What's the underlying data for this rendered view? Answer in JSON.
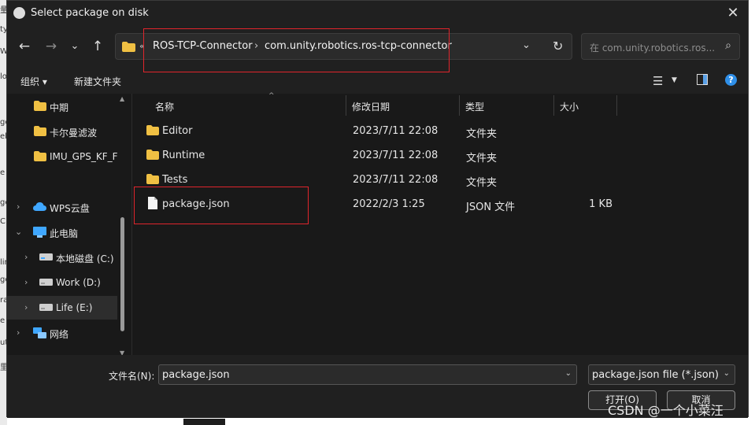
{
  "window": {
    "title": "Select package on disk",
    "close_glyph": "✕"
  },
  "nav": {
    "back_glyph": "←",
    "forward_glyph": "→",
    "recent_glyph": "⌄",
    "up_glyph": "↑",
    "overflow": "«",
    "breadcrumb": [
      "ROS-TCP-Connector",
      "com.unity.robotics.ros-tcp-connector"
    ],
    "separator": "›",
    "dropdown_glyph": "⌄",
    "refresh_glyph": "↻",
    "search_placeholder": "在 com.unity.robotics.ros...",
    "search_glyph": "⌕"
  },
  "toolbar": {
    "organize": "组织 ▾",
    "new_folder": "新建文件夹",
    "view_glyph": "☰",
    "view_caret": "▼",
    "help_glyph": "?"
  },
  "sidebar": {
    "items": [
      {
        "label": "中期",
        "icon": "folder-icon",
        "chevron": ""
      },
      {
        "label": "卡尔曼滤波",
        "icon": "folder-icon",
        "chevron": ""
      },
      {
        "label": "IMU_GPS_KF_F",
        "icon": "folder-icon",
        "chevron": ""
      },
      {
        "label": "WPS云盘",
        "icon": "cloud-icon",
        "chevron": "›"
      },
      {
        "label": "此电脑",
        "icon": "pc-icon",
        "chevron": "⌄"
      },
      {
        "label": "本地磁盘 (C:)",
        "icon": "drive-icon",
        "chevron": "›"
      },
      {
        "label": "Work (D:)",
        "icon": "drive-icon",
        "chevron": "›"
      },
      {
        "label": "Life (E:)",
        "icon": "drive-icon",
        "chevron": "›"
      },
      {
        "label": "网络",
        "icon": "network-icon",
        "chevron": "›"
      }
    ]
  },
  "columns": {
    "name": "名称",
    "date": "修改日期",
    "type": "类型",
    "size": "大小",
    "sort_glyph": "^"
  },
  "files": [
    {
      "name": "Editor",
      "date": "2023/7/11 22:08",
      "type": "文件夹",
      "size": "",
      "icon": "folder-icon"
    },
    {
      "name": "Runtime",
      "date": "2023/7/11 22:08",
      "type": "文件夹",
      "size": "",
      "icon": "folder-icon"
    },
    {
      "name": "Tests",
      "date": "2023/7/11 22:08",
      "type": "文件夹",
      "size": "",
      "icon": "folder-icon"
    },
    {
      "name": "package.json",
      "date": "2022/2/3 1:25",
      "type": "JSON 文件",
      "size": "1 KB",
      "icon": "file-icon"
    }
  ],
  "footer": {
    "filename_label": "文件名(N):",
    "filename_value": "package.json",
    "filter_value": "package.json file (*.json)",
    "open_button": "打开(O)",
    "cancel_button": "取消",
    "caret": "⌄"
  },
  "scroll": {
    "up": "▲",
    "down": "▼"
  },
  "watermark": "CSDN @一个小菜汪",
  "background_fragments": [
    "量",
    "ty",
    "W",
    "lo",
    "ge",
    "ek",
    "e",
    "ge",
    "C",
    "lin",
    "ge",
    "ra",
    "e",
    "ut",
    "里"
  ],
  "colors": {
    "dialog_bg": "#191919",
    "chrome_bg": "#202020",
    "folder": "#f0c043",
    "highlight_box": "#e0252c",
    "help_blue": "#2f8fe8"
  }
}
